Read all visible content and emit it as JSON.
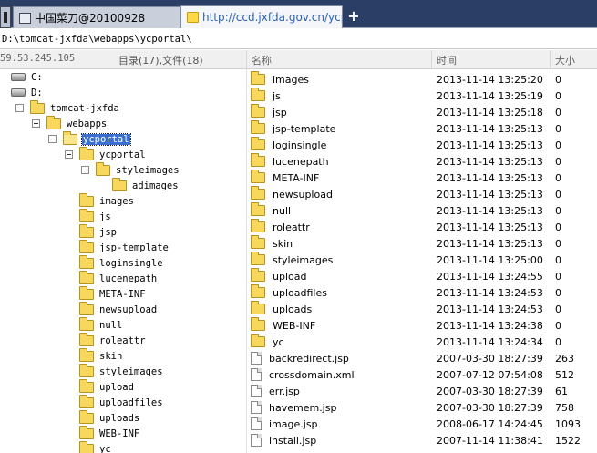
{
  "tabs": [
    {
      "label": "中国菜刀@20100928"
    },
    {
      "label": "http://ccd.jxfda.gov.cn/ycpor..."
    }
  ],
  "new_tab_label": "+",
  "address": "D:\\tomcat-jxfda\\webapps\\ycportal\\",
  "header": {
    "ip": "59.53.245.105",
    "count": "目录(17),文件(18)",
    "col_name": "名称",
    "col_time": "时间",
    "col_size": "大小"
  },
  "tree": [
    {
      "label": "C:",
      "type": "drive",
      "depth": 0,
      "toggle": false
    },
    {
      "label": "D:",
      "type": "drive",
      "depth": 0,
      "toggle": false
    },
    {
      "label": "tomcat-jxfda",
      "type": "folder",
      "depth": 1,
      "toggle": true
    },
    {
      "label": "webapps",
      "type": "folder",
      "depth": 2,
      "toggle": true
    },
    {
      "label": "ycportal",
      "type": "folder-open",
      "depth": 3,
      "toggle": true,
      "selected": true
    },
    {
      "label": "ycportal",
      "type": "folder",
      "depth": 4,
      "toggle": true
    },
    {
      "label": "styleimages",
      "type": "folder",
      "depth": 5,
      "toggle": true
    },
    {
      "label": "adimages",
      "type": "folder",
      "depth": 6,
      "toggle": false
    },
    {
      "label": "images",
      "type": "folder",
      "depth": 4,
      "toggle": false
    },
    {
      "label": "js",
      "type": "folder",
      "depth": 4,
      "toggle": false
    },
    {
      "label": "jsp",
      "type": "folder",
      "depth": 4,
      "toggle": false
    },
    {
      "label": "jsp-template",
      "type": "folder",
      "depth": 4,
      "toggle": false
    },
    {
      "label": "loginsingle",
      "type": "folder",
      "depth": 4,
      "toggle": false
    },
    {
      "label": "lucenepath",
      "type": "folder",
      "depth": 4,
      "toggle": false
    },
    {
      "label": "META-INF",
      "type": "folder",
      "depth": 4,
      "toggle": false
    },
    {
      "label": "newsupload",
      "type": "folder",
      "depth": 4,
      "toggle": false
    },
    {
      "label": "null",
      "type": "folder",
      "depth": 4,
      "toggle": false
    },
    {
      "label": "roleattr",
      "type": "folder",
      "depth": 4,
      "toggle": false
    },
    {
      "label": "skin",
      "type": "folder",
      "depth": 4,
      "toggle": false
    },
    {
      "label": "styleimages",
      "type": "folder",
      "depth": 4,
      "toggle": false
    },
    {
      "label": "upload",
      "type": "folder",
      "depth": 4,
      "toggle": false
    },
    {
      "label": "uploadfiles",
      "type": "folder",
      "depth": 4,
      "toggle": false
    },
    {
      "label": "uploads",
      "type": "folder",
      "depth": 4,
      "toggle": false
    },
    {
      "label": "WEB-INF",
      "type": "folder",
      "depth": 4,
      "toggle": false
    },
    {
      "label": "yc",
      "type": "folder",
      "depth": 4,
      "toggle": false
    }
  ],
  "files": [
    {
      "name": "images",
      "time": "2013-11-14 13:25:20",
      "size": "0",
      "type": "folder"
    },
    {
      "name": "js",
      "time": "2013-11-14 13:25:19",
      "size": "0",
      "type": "folder"
    },
    {
      "name": "jsp",
      "time": "2013-11-14 13:25:18",
      "size": "0",
      "type": "folder"
    },
    {
      "name": "jsp-template",
      "time": "2013-11-14 13:25:13",
      "size": "0",
      "type": "folder"
    },
    {
      "name": "loginsingle",
      "time": "2013-11-14 13:25:13",
      "size": "0",
      "type": "folder"
    },
    {
      "name": "lucenepath",
      "time": "2013-11-14 13:25:13",
      "size": "0",
      "type": "folder"
    },
    {
      "name": "META-INF",
      "time": "2013-11-14 13:25:13",
      "size": "0",
      "type": "folder"
    },
    {
      "name": "newsupload",
      "time": "2013-11-14 13:25:13",
      "size": "0",
      "type": "folder"
    },
    {
      "name": "null",
      "time": "2013-11-14 13:25:13",
      "size": "0",
      "type": "folder"
    },
    {
      "name": "roleattr",
      "time": "2013-11-14 13:25:13",
      "size": "0",
      "type": "folder"
    },
    {
      "name": "skin",
      "time": "2013-11-14 13:25:13",
      "size": "0",
      "type": "folder"
    },
    {
      "name": "styleimages",
      "time": "2013-11-14 13:25:00",
      "size": "0",
      "type": "folder"
    },
    {
      "name": "upload",
      "time": "2013-11-14 13:24:55",
      "size": "0",
      "type": "folder"
    },
    {
      "name": "uploadfiles",
      "time": "2013-11-14 13:24:53",
      "size": "0",
      "type": "folder"
    },
    {
      "name": "uploads",
      "time": "2013-11-14 13:24:53",
      "size": "0",
      "type": "folder"
    },
    {
      "name": "WEB-INF",
      "time": "2013-11-14 13:24:38",
      "size": "0",
      "type": "folder"
    },
    {
      "name": "yc",
      "time": "2013-11-14 13:24:34",
      "size": "0",
      "type": "folder"
    },
    {
      "name": "backredirect.jsp",
      "time": "2007-03-30 18:27:39",
      "size": "263",
      "type": "file"
    },
    {
      "name": "crossdomain.xml",
      "time": "2007-07-12 07:54:08",
      "size": "512",
      "type": "file"
    },
    {
      "name": "err.jsp",
      "time": "2007-03-30 18:27:39",
      "size": "61",
      "type": "file"
    },
    {
      "name": "havemem.jsp",
      "time": "2007-03-30 18:27:39",
      "size": "758",
      "type": "file"
    },
    {
      "name": "image.jsp",
      "time": "2008-06-17 14:24:45",
      "size": "1093",
      "type": "file"
    },
    {
      "name": "install.jsp",
      "time": "2007-11-14 11:38:41",
      "size": "1522",
      "type": "file"
    }
  ]
}
